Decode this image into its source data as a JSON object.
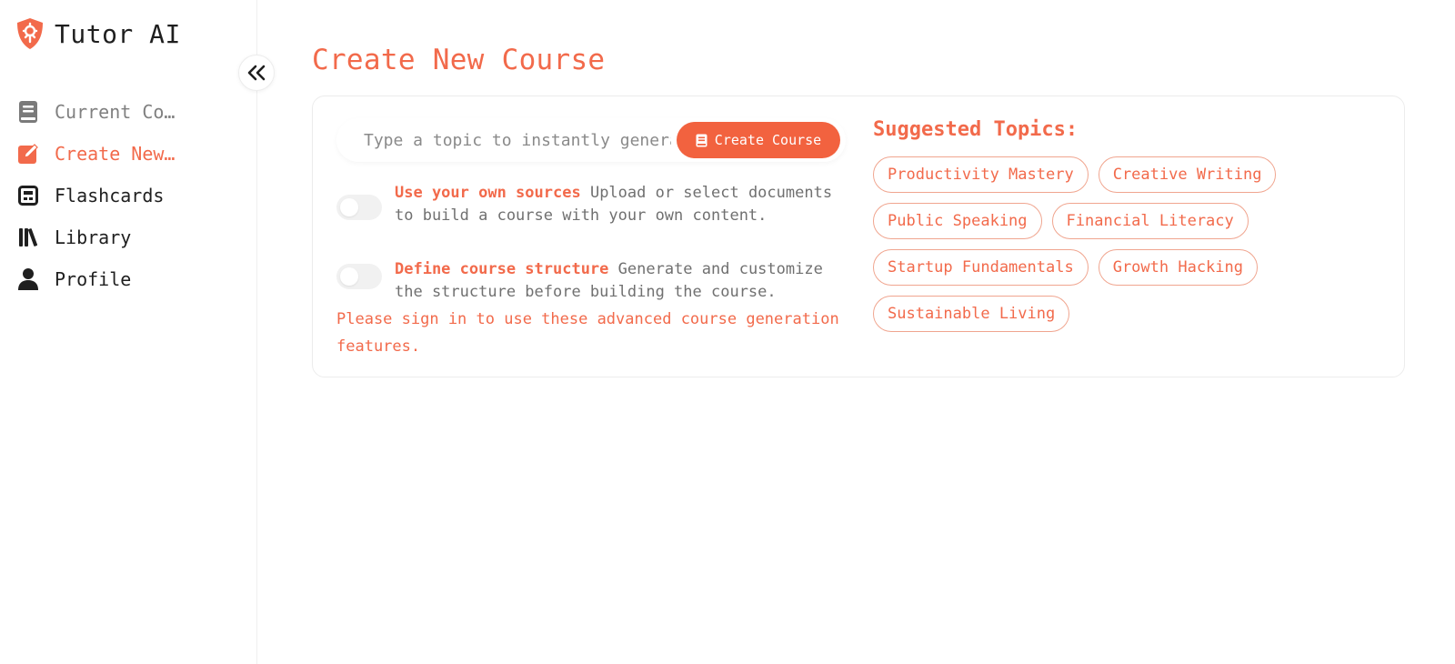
{
  "brand": {
    "name": "Tutor AI",
    "logo_icon": "shield-logo-icon",
    "accent": "#f26a4b"
  },
  "sidebar": {
    "collapse_icon": "double-chevron-left-icon",
    "items": [
      {
        "label": "Current Course",
        "icon": "book-icon",
        "state": "muted"
      },
      {
        "label": "Create New Course",
        "icon": "edit-icon",
        "state": "active"
      },
      {
        "label": "Flashcards",
        "icon": "flashcard-icon",
        "state": "normal"
      },
      {
        "label": "Library",
        "icon": "library-icon",
        "state": "normal"
      },
      {
        "label": "Profile",
        "icon": "user-icon",
        "state": "normal"
      }
    ]
  },
  "main": {
    "title": "Create New Course",
    "topic_input": {
      "placeholder": "Type a topic to instantly generate a course",
      "value": ""
    },
    "create_button": {
      "label": "Create Course",
      "icon": "book-icon"
    },
    "options": [
      {
        "title": "Use your own sources",
        "description": "Upload or select documents to build a course with your own content.",
        "enabled": false
      },
      {
        "title": "Define course structure",
        "description": "Generate and customize the structure before building the course.",
        "enabled": false
      }
    ],
    "signin_note": "Please sign in to use these advanced course generation features.",
    "suggested": {
      "title": "Suggested Topics:",
      "topics": [
        "Productivity Mastery",
        "Creative Writing",
        "Public Speaking",
        "Financial Literacy",
        "Startup Fundamentals",
        "Growth Hacking",
        "Sustainable Living"
      ]
    }
  }
}
